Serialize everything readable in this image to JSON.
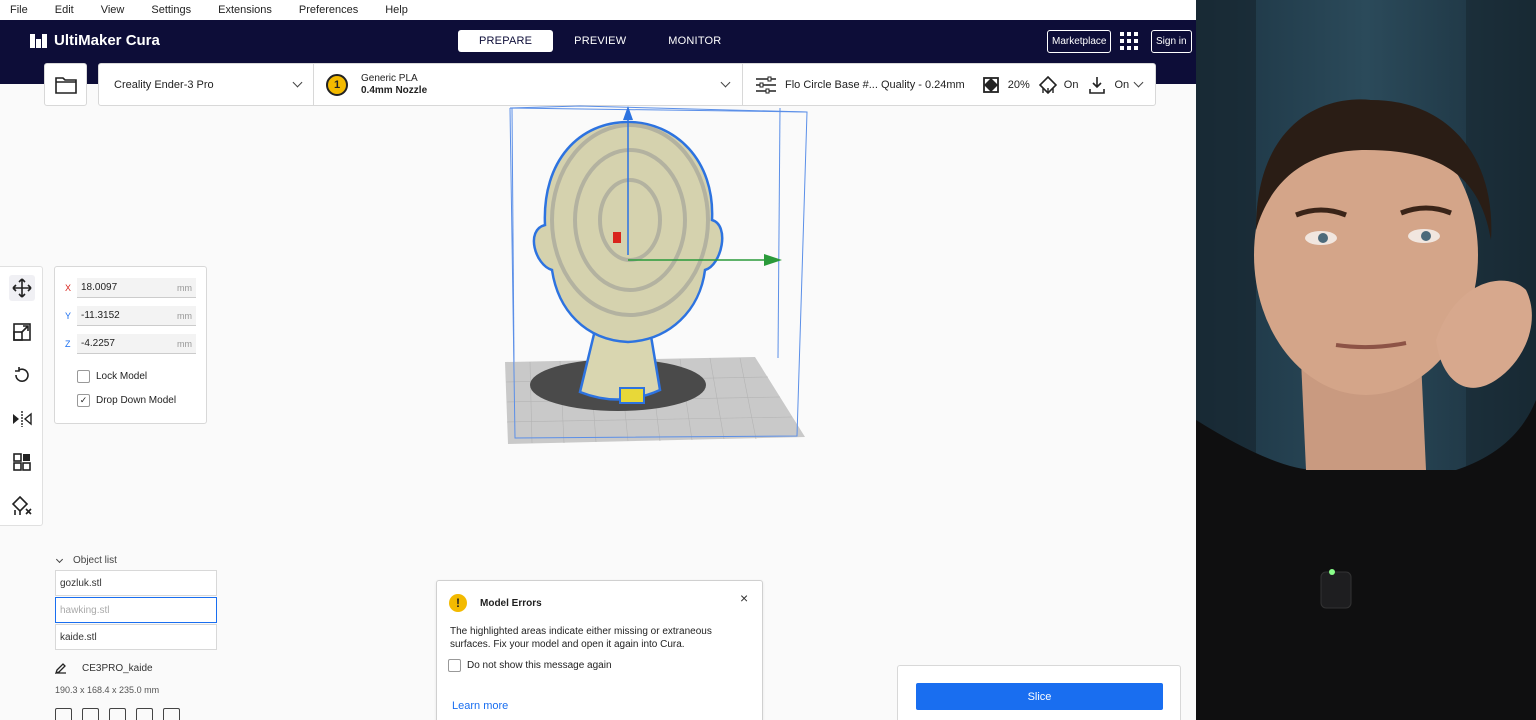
{
  "menu": [
    "File",
    "Edit",
    "View",
    "Settings",
    "Extensions",
    "Preferences",
    "Help"
  ],
  "header": {
    "app_name": "UltiMaker Cura",
    "stages": [
      "PREPARE",
      "PREVIEW",
      "MONITOR"
    ],
    "active_stage": "PREPARE",
    "marketplace": "Marketplace",
    "sign_in": "Sign in"
  },
  "config": {
    "printer": "Creality Ender-3 Pro",
    "extruder_number": "1",
    "material": "Generic PLA",
    "nozzle": "0.4mm Nozzle",
    "profile": "Flo Circle Base #... Quality - 0.24mm",
    "infill": "20%",
    "support": "On",
    "adhesion": "On"
  },
  "move_panel": {
    "x_label": "X",
    "x_value": "18.0097",
    "y_label": "Y",
    "y_value": "-11.3152",
    "z_label": "Z",
    "z_value": "-4.2257",
    "unit": "mm",
    "lock_model": "Lock Model",
    "drop_down_model": "Drop Down Model",
    "drop_down_checked": "✓"
  },
  "object_list": {
    "heading": "Object list",
    "items": [
      "gozluk.stl",
      "hawking.stl",
      "kaide.stl"
    ],
    "printer_name": "CE3PRO_kaide",
    "dimensions": "190.3 x 168.4 x 235.0 mm"
  },
  "model_errors": {
    "icon": "!",
    "title": "Model Errors",
    "body": "The highlighted areas indicate either missing or extraneous surfaces. Fix your model and open it again into Cura.",
    "checkbox": "Do not show this message again",
    "link": "Learn more",
    "close": "×"
  },
  "slice": {
    "label": "Slice"
  },
  "colors": {
    "header_bg": "#0d0d38",
    "accent": "#196ef0",
    "warning": "#f3ba00"
  },
  "icons": [
    "folder-icon",
    "chevron-down-icon",
    "extruder-icon",
    "settings-sliders-icon",
    "infill-icon",
    "support-icon",
    "adhesion-icon",
    "move-icon",
    "scale-icon",
    "rotate-icon",
    "mirror-icon",
    "per-model-settings-icon",
    "support-blocker-icon",
    "pencil-icon",
    "apps-grid-icon"
  ]
}
